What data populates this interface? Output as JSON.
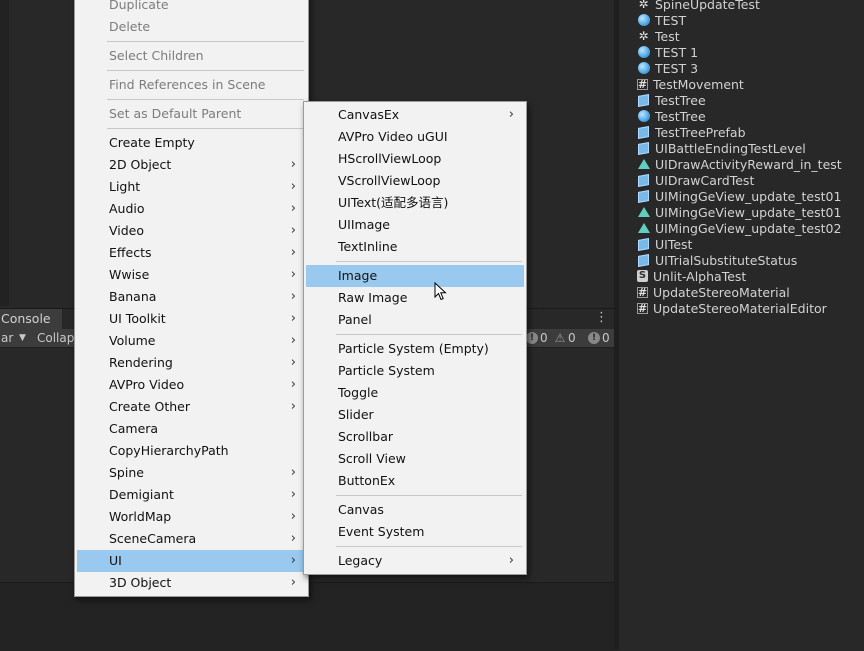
{
  "console": {
    "tab_label": "Console",
    "clear_label": "ar",
    "collapse_label": "Collap",
    "counts": [
      "0",
      "0",
      "0"
    ]
  },
  "hierarchy": {
    "items": [
      {
        "label": "SpineUpdateTest",
        "icon": "gear-icon"
      },
      {
        "label": "TEST",
        "icon": "scene-icon"
      },
      {
        "label": "Test",
        "icon": "gear-icon"
      },
      {
        "label": "TEST 1",
        "icon": "scene-icon"
      },
      {
        "label": "TEST 3",
        "icon": "scene-icon"
      },
      {
        "label": "TestMovement",
        "icon": "script-icon"
      },
      {
        "label": "TestTree",
        "icon": "prefab-icon"
      },
      {
        "label": "TestTree",
        "icon": "scene-icon"
      },
      {
        "label": "TestTreePrefab",
        "icon": "prefab-icon"
      },
      {
        "label": "UIBattleEndingTestLevel",
        "icon": "prefab-icon"
      },
      {
        "label": "UIDrawActivityReward_in_test",
        "icon": "shader-icon"
      },
      {
        "label": "UIDrawCardTest",
        "icon": "prefab-icon"
      },
      {
        "label": "UIMingGeView_update_test01",
        "icon": "prefab-icon"
      },
      {
        "label": "UIMingGeView_update_test01",
        "icon": "shader-icon"
      },
      {
        "label": "UIMingGeView_update_test02",
        "icon": "shader-icon"
      },
      {
        "label": "UITest",
        "icon": "prefab-icon"
      },
      {
        "label": "UITrialSubstituteStatus",
        "icon": "prefab-icon"
      },
      {
        "label": "Unlit-AlphaTest",
        "icon": "shader-s-icon"
      },
      {
        "label": "UpdateStereoMaterial",
        "icon": "script-icon"
      },
      {
        "label": "UpdateStereoMaterialEditor",
        "icon": "script-icon"
      }
    ]
  },
  "main_menu": {
    "items": [
      {
        "label": "Duplicate",
        "disabled": true
      },
      {
        "label": "Delete",
        "disabled": true
      },
      {
        "label": "Select Children",
        "disabled": true
      },
      {
        "label": "Find References in Scene",
        "disabled": true
      },
      {
        "label": "Set as Default Parent",
        "disabled": true
      },
      {
        "label": "Create Empty"
      },
      {
        "label": "2D Object",
        "submenu": true
      },
      {
        "label": "Light",
        "submenu": true
      },
      {
        "label": "Audio",
        "submenu": true
      },
      {
        "label": "Video",
        "submenu": true
      },
      {
        "label": "Effects",
        "submenu": true
      },
      {
        "label": "Wwise",
        "submenu": true
      },
      {
        "label": "Banana",
        "submenu": true
      },
      {
        "label": "UI Toolkit",
        "submenu": true
      },
      {
        "label": "Volume",
        "submenu": true
      },
      {
        "label": "Rendering",
        "submenu": true
      },
      {
        "label": "AVPro Video",
        "submenu": true
      },
      {
        "label": "Create Other",
        "submenu": true
      },
      {
        "label": "Camera"
      },
      {
        "label": "CopyHierarchyPath"
      },
      {
        "label": "Spine",
        "submenu": true
      },
      {
        "label": "Demigiant",
        "submenu": true
      },
      {
        "label": "WorldMap",
        "submenu": true
      },
      {
        "label": "SceneCamera",
        "submenu": true
      },
      {
        "label": "UI",
        "submenu": true,
        "active": true
      },
      {
        "label": "3D Object",
        "submenu": true
      }
    ]
  },
  "ui_submenu": {
    "items": [
      {
        "label": "CanvasEx",
        "submenu": true
      },
      {
        "label": "AVPro Video uGUI"
      },
      {
        "label": "HScrollViewLoop"
      },
      {
        "label": "VScrollViewLoop"
      },
      {
        "label": "UIText(适配多语言)"
      },
      {
        "label": "UIImage"
      },
      {
        "label": "TextInline"
      },
      {
        "label": "Image",
        "active": true
      },
      {
        "label": "Raw Image"
      },
      {
        "label": "Panel"
      },
      {
        "label": "Particle System (Empty)"
      },
      {
        "label": "Particle System"
      },
      {
        "label": "Toggle"
      },
      {
        "label": "Slider"
      },
      {
        "label": "Scrollbar"
      },
      {
        "label": "Scroll View"
      },
      {
        "label": "ButtonEx"
      },
      {
        "label": "Canvas"
      },
      {
        "label": "Event System"
      },
      {
        "label": "Legacy",
        "submenu": true
      }
    ]
  },
  "colors": {
    "menu_bg": "#f2f2f2",
    "highlight": "#99c9ef",
    "editor_bg": "#282828"
  }
}
